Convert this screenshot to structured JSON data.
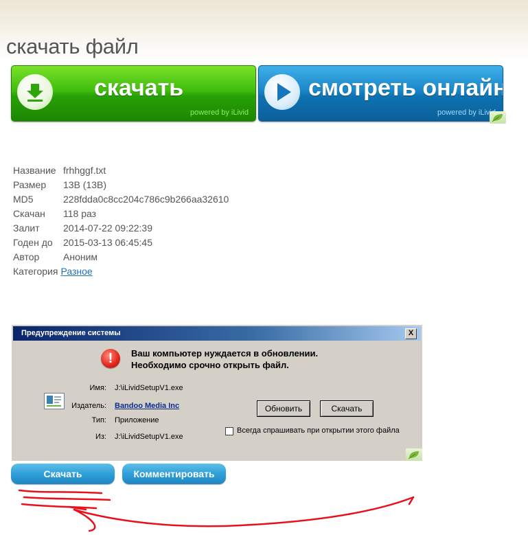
{
  "page": {
    "title": "скачать файл"
  },
  "promo": {
    "download_label": "скачать",
    "download_powered": "powered by iLivid",
    "watch_label": "смотреть онлайн",
    "watch_powered": "powered by iLivid"
  },
  "file_info": {
    "rows": [
      {
        "key": "Название",
        "value": "frhhggf.txt"
      },
      {
        "key": "Размер",
        "value": "13B (13B)"
      },
      {
        "key": "MD5",
        "value": "228fdda0c8cc204c786c9b266aa32610"
      },
      {
        "key": "Скачан",
        "value": "118 раз"
      },
      {
        "key": "Залит",
        "value": "2014-07-22 09:22:39"
      },
      {
        "key": "Годен до",
        "value": "2015-03-13 06:45:45"
      },
      {
        "key": "Автор",
        "value": "Аноним"
      }
    ],
    "category_key": "Категория",
    "category_link": "Разное"
  },
  "dialog": {
    "title": "Предупреждение системы",
    "close": "X",
    "error_symbol": "!",
    "message_line1": "Ваш компьютер нуждается в обновлении.",
    "message_line2": "Необходимо срочно открыть файл.",
    "name_label": "Имя:",
    "name_value": "J:\\iLividSetupV1.exe",
    "publisher_label": "Издатель:",
    "publisher_value": "Bandoo Media Inc",
    "type_label": "Тип:",
    "type_value": "Приложение",
    "from_label": "Из:",
    "from_value": "J:\\iLividSetupV1.exe",
    "update_button": "Обновить",
    "download_button": "Скачать",
    "always_ask_label": "Всегда спрашивать при открытии этого файла"
  },
  "actions": {
    "download": "Скачать",
    "comment": "Комментировать"
  },
  "colors": {
    "green_button": "#3fbd0c",
    "blue_button": "#1a86c8",
    "annotation_red": "#e8101a",
    "dialog_title": "#0a246a"
  }
}
